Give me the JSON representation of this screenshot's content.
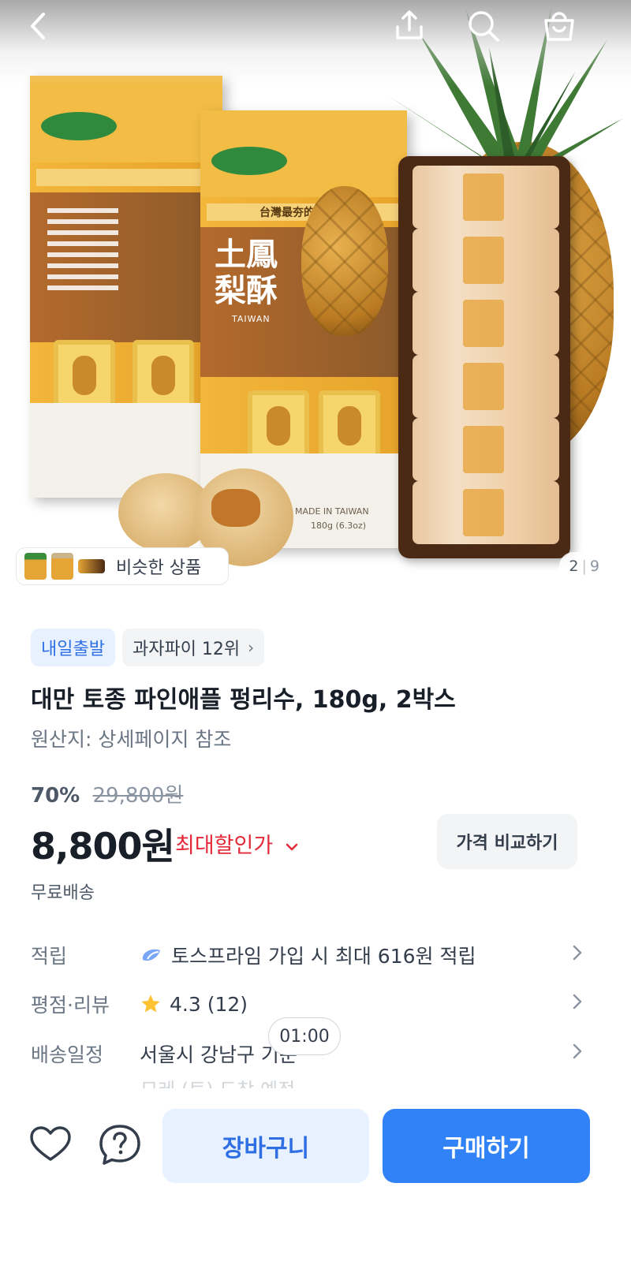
{
  "gallery": {
    "similar_label": "비슷한 상품",
    "page_current": "2",
    "page_separator": "|",
    "page_total": "9",
    "product_image_text": {
      "brand_slogan": "台灣最夯的伴手禮",
      "product_name": "土鳳梨酥",
      "sub_name": "TAIWAN",
      "origin_text": "MADE IN TAIWAN",
      "weight_text": "180g (6.3oz)"
    }
  },
  "header": {
    "icons": [
      "back-icon",
      "share-icon",
      "search-icon",
      "cart-icon"
    ]
  },
  "badges": {
    "delivery": "내일출발",
    "ranking": "과자파이 12위",
    "ranking_chevron": "›"
  },
  "product": {
    "title": "대만 토종 파인애플 펑리수, 180g, 2박스",
    "origin": "원산지: 상세페이지 참조",
    "discount_rate": "70%",
    "original_price": "29,800원",
    "price": "8,800원",
    "max_discount_label": "최대할인가",
    "compare_button": "가격 비교하기",
    "shipping": "무료배송"
  },
  "info_rows": {
    "points_label": "적립",
    "points_value": "토스프라임 가입 시 최대 616원 적립",
    "rating_label": "평점·리뷰",
    "rating_value": "4.3 (12)",
    "delivery_label": "배송일정",
    "delivery_value": "서울시 강남구 기준",
    "delivery_sub": "모레 (토) 도착 예정"
  },
  "timer": "01:00",
  "bottom_bar": {
    "cart_button": "장바구니",
    "buy_button": "구매하기"
  },
  "colors": {
    "primary": "#3182f6",
    "primary_light": "#e8f1ff",
    "discount_red": "#e42939",
    "star": "#ffc233"
  }
}
